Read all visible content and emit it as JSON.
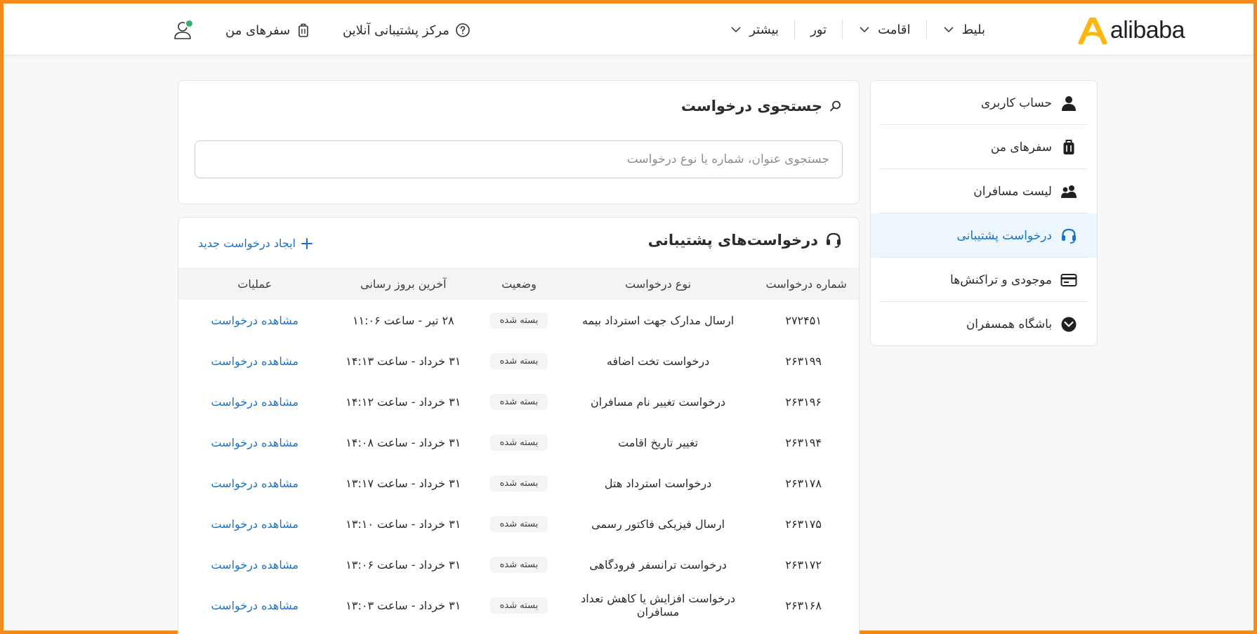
{
  "header": {
    "logo_text": "alibaba",
    "nav": [
      {
        "label": "بلیط",
        "has_dropdown": true
      },
      {
        "label": "اقامت",
        "has_dropdown": true
      },
      {
        "label": "تور",
        "has_dropdown": false
      },
      {
        "label": "بیشتر",
        "has_dropdown": true
      }
    ],
    "support_center": "مرکز پشتیبانی آنلاین",
    "my_trips": "سفرهای من",
    "user_icon": "user-icon",
    "user_status_color": "#2fb36b"
  },
  "sidebar": {
    "items": [
      {
        "label": "حساب کاربری",
        "icon": "user-icon",
        "active": false
      },
      {
        "label": "سفرهای من",
        "icon": "suitcase-icon",
        "active": false
      },
      {
        "label": "لیست مسافران",
        "icon": "users-icon",
        "active": false
      },
      {
        "label": "درخواست پشتیبانی",
        "icon": "headset-icon",
        "active": true
      },
      {
        "label": "موجودی و تراکنش‌ها",
        "icon": "card-icon",
        "active": false
      },
      {
        "label": "باشگاه همسفران",
        "icon": "club-icon",
        "active": false
      }
    ]
  },
  "search": {
    "title": "جستجوی درخواست",
    "placeholder": "جستجوی عنوان، شماره یا نوع درخواست",
    "value": ""
  },
  "requests": {
    "title": "درخواست‌های پشتیبانی",
    "new_label": "ایجاد درخواست جدید",
    "columns": [
      "شماره درخواست",
      "نوع درخواست",
      "وضعیت",
      "آخرین بروز رسانی",
      "عملیات"
    ],
    "rows": [
      {
        "number": "۲۷۲۴۵۱",
        "type": "ارسال مدارک جهت استرداد بیمه",
        "status": "بسته شده",
        "updated": "۲۸ تیر - ساعت ۱۱:۰۶",
        "action": "مشاهده درخواست"
      },
      {
        "number": "۲۶۳۱۹۹",
        "type": "درخواست تخت اضافه",
        "status": "بسته شده",
        "updated": "۳۱ خرداد - ساعت ۱۴:۱۳",
        "action": "مشاهده درخواست"
      },
      {
        "number": "۲۶۳۱۹۶",
        "type": "درخواست تغییر نام مسافران",
        "status": "بسته شده",
        "updated": "۳۱ خرداد - ساعت ۱۴:۱۲",
        "action": "مشاهده درخواست"
      },
      {
        "number": "۲۶۳۱۹۴",
        "type": "تغییر تاریخ اقامت",
        "status": "بسته شده",
        "updated": "۳۱ خرداد - ساعت ۱۴:۰۸",
        "action": "مشاهده درخواست"
      },
      {
        "number": "۲۶۳۱۷۸",
        "type": "درخواست استرداد هتل",
        "status": "بسته شده",
        "updated": "۳۱ خرداد - ساعت ۱۳:۱۷",
        "action": "مشاهده درخواست"
      },
      {
        "number": "۲۶۳۱۷۵",
        "type": "ارسال فیزیکی فاکتور رسمی",
        "status": "بسته شده",
        "updated": "۳۱ خرداد - ساعت ۱۳:۱۰",
        "action": "مشاهده درخواست"
      },
      {
        "number": "۲۶۳۱۷۲",
        "type": "درخواست ترانسفر فرودگاهی",
        "status": "بسته شده",
        "updated": "۳۱ خرداد - ساعت ۱۳:۰۶",
        "action": "مشاهده درخواست"
      },
      {
        "number": "۲۶۳۱۶۸",
        "type": "درخواست افزایش یا کاهش تعداد مسافران",
        "status": "بسته شده",
        "updated": "۳۱ خرداد - ساعت ۱۳:۰۳",
        "action": "مشاهده درخواست"
      }
    ]
  },
  "colors": {
    "brand": "#fdb713",
    "accent": "#1a73c7",
    "frame": "#f28a1d"
  }
}
